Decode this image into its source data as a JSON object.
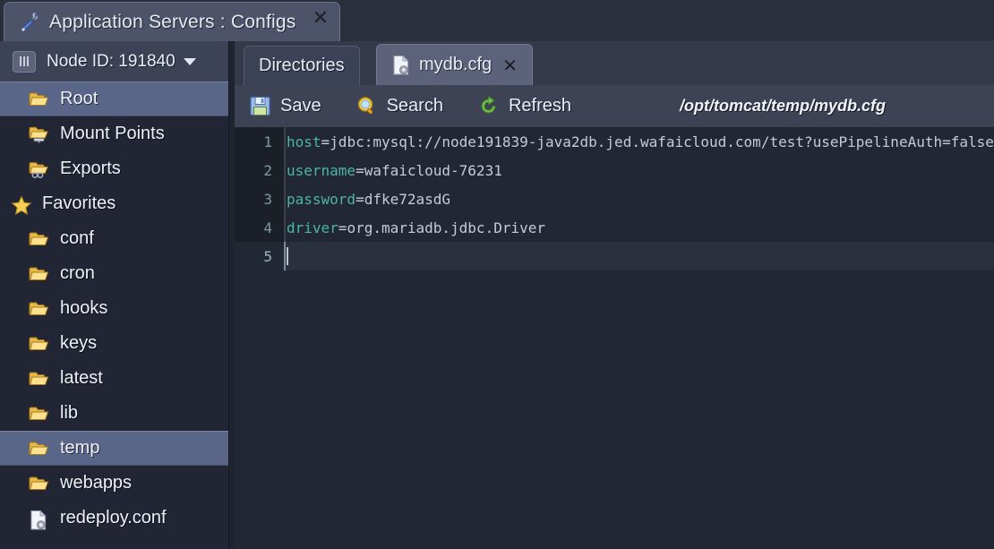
{
  "window": {
    "tab_title": "Application Servers : Configs",
    "tab_icon": "screwdriver-wrench-icon",
    "close_label": "✕"
  },
  "sidebar": {
    "node_header": {
      "icon": "columns-icon",
      "label": "Node ID: 191840",
      "caret": "chevron-down-icon"
    },
    "items": [
      {
        "label": "Root",
        "icon": "folder-icon",
        "selected": true,
        "group": false
      },
      {
        "label": "Mount Points",
        "icon": "folder-mount-icon",
        "selected": false,
        "group": false
      },
      {
        "label": "Exports",
        "icon": "folder-link-icon",
        "selected": false,
        "group": false
      },
      {
        "label": "Favorites",
        "icon": "star-icon",
        "selected": false,
        "group": true
      },
      {
        "label": "conf",
        "icon": "folder-icon",
        "selected": false,
        "group": false
      },
      {
        "label": "cron",
        "icon": "folder-icon",
        "selected": false,
        "group": false
      },
      {
        "label": "hooks",
        "icon": "folder-icon",
        "selected": false,
        "group": false
      },
      {
        "label": "keys",
        "icon": "folder-icon",
        "selected": false,
        "group": false
      },
      {
        "label": "latest",
        "icon": "folder-icon",
        "selected": false,
        "group": false
      },
      {
        "label": "lib",
        "icon": "folder-icon",
        "selected": false,
        "group": false
      },
      {
        "label": "temp",
        "icon": "folder-icon",
        "selected": true,
        "group": false
      },
      {
        "label": "webapps",
        "icon": "folder-icon",
        "selected": false,
        "group": false
      },
      {
        "label": "redeploy.conf",
        "icon": "file-config-icon",
        "selected": false,
        "group": false
      }
    ]
  },
  "main": {
    "tabs": [
      {
        "label": "Directories",
        "icon": null,
        "active": false,
        "closable": false
      },
      {
        "label": "mydb.cfg",
        "icon": "file-config-icon",
        "active": true,
        "closable": true,
        "close_label": "✕"
      }
    ],
    "toolbar": {
      "buttons": [
        {
          "label": "Save",
          "icon": "floppy-disk-icon"
        },
        {
          "label": "Search",
          "icon": "magnifier-icon"
        },
        {
          "label": "Refresh",
          "icon": "refresh-icon"
        }
      ],
      "file_path": "/opt/tomcat/temp/mydb.cfg"
    },
    "editor": {
      "lines": [
        {
          "n": "1",
          "key": "host",
          "sep": "=",
          "value": "jdbc:mysql://node191839-java2db.jed.wafaicloud.com/test?usePipelineAuth=false",
          "active": false
        },
        {
          "n": "2",
          "key": "username",
          "sep": "=",
          "value": "wafaicloud-76231",
          "active": false
        },
        {
          "n": "3",
          "key": "password",
          "sep": "=",
          "value": "dfke72asdG",
          "active": false
        },
        {
          "n": "4",
          "key": "driver",
          "sep": "=",
          "value": "org.mariadb.jdbc.Driver",
          "active": false
        },
        {
          "n": "5",
          "key": "",
          "sep": "",
          "value": "",
          "active": true
        }
      ]
    }
  },
  "colors": {
    "window_bg": "#2b2f3c",
    "sidebar_bg": "#222634",
    "selection": "#5a6687",
    "toolbar_bg": "#3d4354",
    "editor_bg": "#212733",
    "gutter_bg": "#1b2028",
    "key_color": "#4db5a6",
    "value_color": "#c6ccd6",
    "folder_gold": "#f4c860"
  }
}
